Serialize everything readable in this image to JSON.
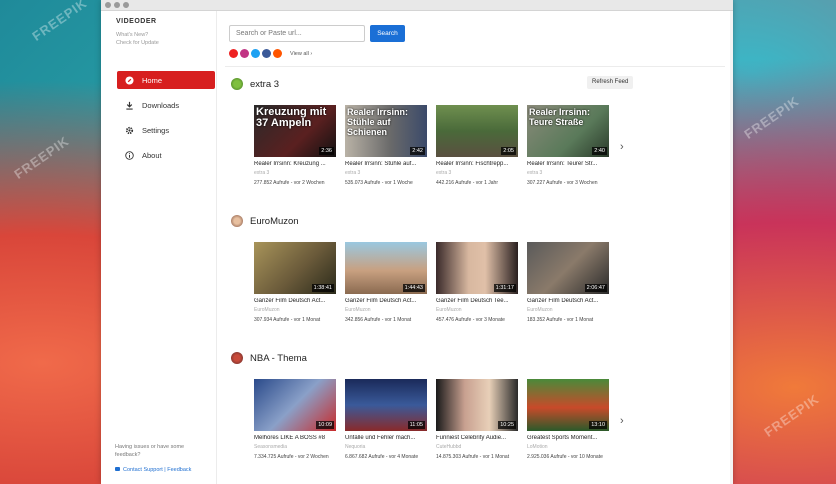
{
  "watermark": "FREEPIK",
  "app": {
    "brand": "VIDEODER",
    "whats_new": "What's New?",
    "check_update": "Check for Update"
  },
  "nav": [
    {
      "label": "Home",
      "icon": "home-icon",
      "active": true
    },
    {
      "label": "Downloads",
      "icon": "download-icon",
      "active": false
    },
    {
      "label": "Settings",
      "icon": "gear-icon",
      "active": false
    },
    {
      "label": "About",
      "icon": "info-icon",
      "active": false
    }
  ],
  "footer": {
    "issue": "Having issues or have some feedback?",
    "contact": "Contact Support | Feedback"
  },
  "search": {
    "placeholder": "Search or Paste url...",
    "button": "Search",
    "view_all": "View all ›"
  },
  "refresh_label": "Refresh Feed",
  "sections": [
    {
      "title": "extra 3",
      "cards": [
        {
          "thumb_text": "Kreuzung mit 37 Ampeln",
          "duration": "2:36",
          "title": "Realer Irrsinn: Kreuzung ...",
          "channel": "extra 3",
          "meta": "277.852 Aufrufe - vor 2 Wochen"
        },
        {
          "thumb_text": "Realer Irrsinn: Stühle auf Schienen",
          "duration": "2:42",
          "title": "Realer Irrsinn: Stühle auf...",
          "channel": "extra 3",
          "meta": "535.073 Aufrufe - vor 1 Woche"
        },
        {
          "thumb_text": "",
          "duration": "2:05",
          "title": "Realer Irrsinn: Fischtrepp...",
          "channel": "extra 3",
          "meta": "442.216 Aufrufe - vor 1 Jahr"
        },
        {
          "thumb_text": "Realer Irrsinn: Teure Straße",
          "duration": "2:40",
          "title": "Realer Irrsinn: Teurer Str...",
          "channel": "extra 3",
          "meta": "307.227 Aufrufe - vor 3 Wochen"
        }
      ]
    },
    {
      "title": "EuroMuzon",
      "cards": [
        {
          "thumb_text": "",
          "duration": "1:38:41",
          "title": "Ganzer Film Deutsch Act...",
          "channel": "EuroMuzon",
          "meta": "307.934 Aufrufe - vor 1 Monat"
        },
        {
          "thumb_text": "",
          "duration": "1:44:43",
          "title": "Ganzer Film Deutsch Act...",
          "channel": "EuroMuzon",
          "meta": "342.856 Aufrufe - vor 1 Monat"
        },
        {
          "thumb_text": "",
          "duration": "1:31:17",
          "title": "Ganzer Film Deutsch Tee...",
          "channel": "EuroMuzon",
          "meta": "457.476 Aufrufe - vor 3 Monate"
        },
        {
          "thumb_text": "",
          "duration": "2:06:47",
          "title": "Ganzer Film Deutsch Act...",
          "channel": "EuroMuzon",
          "meta": "183.352 Aufrufe - vor 1 Monat"
        }
      ]
    },
    {
      "title": "NBA - Thema",
      "cards": [
        {
          "thumb_text": "",
          "duration": "10:09",
          "title": "Melhores LIKE A BOSS #8",
          "channel": "Seasonsmedia",
          "meta": "7.334.725 Aufrufe - vor 2 Wochen"
        },
        {
          "thumb_text": "",
          "duration": "11:05",
          "title": "Unfälle und Fehler mach...",
          "channel": "Nequoria",
          "meta": "6.867.682 Aufrufe - vor 4 Monate"
        },
        {
          "thumb_text": "",
          "duration": "10:25",
          "title": "Funniest Celebrity Audie...",
          "channel": "CuteHubbd",
          "meta": "14.875.303 Aufrufe - vor 1 Monat"
        },
        {
          "thumb_text": "",
          "duration": "13:10",
          "title": "Greatest Sports Moment...",
          "channel": "LoMotion",
          "meta": "2.925.036 Aufrufe - vor 10 Monate"
        }
      ]
    }
  ],
  "colors": {
    "accent": "#d71f1f",
    "button": "#1a6fd6"
  }
}
